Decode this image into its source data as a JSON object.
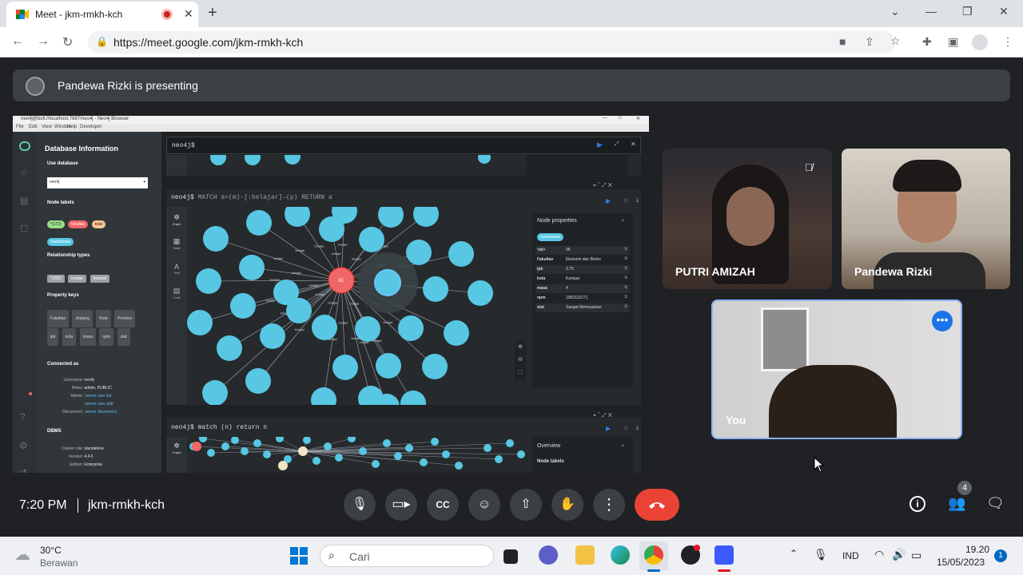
{
  "browser": {
    "tab_title": "Meet - jkm-rmkh-kch",
    "url": "https://meet.google.com/jkm-rmkh-kch"
  },
  "meet": {
    "presenting_text": "Pandewa Rizki is presenting",
    "time": "7:20 PM",
    "meeting_code": "jkm-rmkh-kch",
    "participant_count": "4",
    "participants": [
      {
        "name": "PUTRI AMIZAH"
      },
      {
        "name": "Pandewa Rizki"
      },
      {
        "name": "You"
      }
    ]
  },
  "neo4j": {
    "window_title": "neo4j@bolt://localhost:7687/neo4j - Neo4j Browser",
    "menu": [
      "File",
      "Edit",
      "View",
      "Window",
      "Help",
      "Developer"
    ],
    "db_info_title": "Database Information",
    "use_database_label": "Use database",
    "db_select_value": "neo4j",
    "node_labels_title": "Node labels",
    "node_labels": [
      "*(172)",
      "fakultas",
      "kota",
      "mahasiswa"
    ],
    "rel_types_title": "Relationship types",
    "rel_types": [
      "*(200)",
      "belajar",
      "berasal"
    ],
    "prop_keys_title": "Property keys",
    "prop_keys": [
      "Fakultas",
      "Jenjang",
      "Kota",
      "Provinsi",
      "ipk",
      "kota",
      "masa",
      "npm",
      "stat"
    ],
    "connected_as_title": "Connected as",
    "conn": [
      {
        "k": "Username:",
        "v": "neo4j"
      },
      {
        "k": "Roles:",
        "v": "admin, PUBLIC"
      },
      {
        "k": "Admin:",
        "v": ":server user list"
      },
      {
        "k": "",
        "v": ":server user add"
      },
      {
        "k": "Disconnect:",
        "v": ":server disconnect"
      }
    ],
    "dbms_title": "DBMS",
    "dbms": [
      {
        "k": "Cluster role:",
        "v": "standalone"
      },
      {
        "k": "Version:",
        "v": "4.4.6"
      },
      {
        "k": "Edition:",
        "v": "Enterprise"
      }
    ],
    "prompt": "neo4j$",
    "query1": "MATCH a=(m)-[:belajar]→(p) RETURN a",
    "query2": "match (n) return n",
    "side_tabs": [
      "Graph",
      "Table",
      "Text",
      "Code"
    ],
    "node_props_title": "Node properties",
    "node_props_label": "mahasiswa",
    "node_props": [
      {
        "k": "<id>",
        "v": "96"
      },
      {
        "k": "Fakultas",
        "v": "Ekonomi dan Bisnis"
      },
      {
        "k": "ipk",
        "v": "3.75"
      },
      {
        "k": "kota",
        "v": "Kampar"
      },
      {
        "k": "masa",
        "v": "4"
      },
      {
        "k": "npm",
        "v": "1953110271"
      },
      {
        "k": "stat",
        "v": "Sangat Memuaskan"
      }
    ],
    "center_node": "81",
    "edge_label": "belajar",
    "overview_title": "Overview",
    "overview_node_labels": "Node labels"
  },
  "taskbar": {
    "weather_temp": "30°C",
    "weather_desc": "Berawan",
    "search_placeholder": "Cari",
    "lang": "IND",
    "clock_time": "19.20",
    "clock_date": "15/05/2023",
    "notif_count": "1"
  },
  "colors": {
    "node": "#57c7e3",
    "center_node": "#f16667",
    "end_call": "#ea4335"
  }
}
